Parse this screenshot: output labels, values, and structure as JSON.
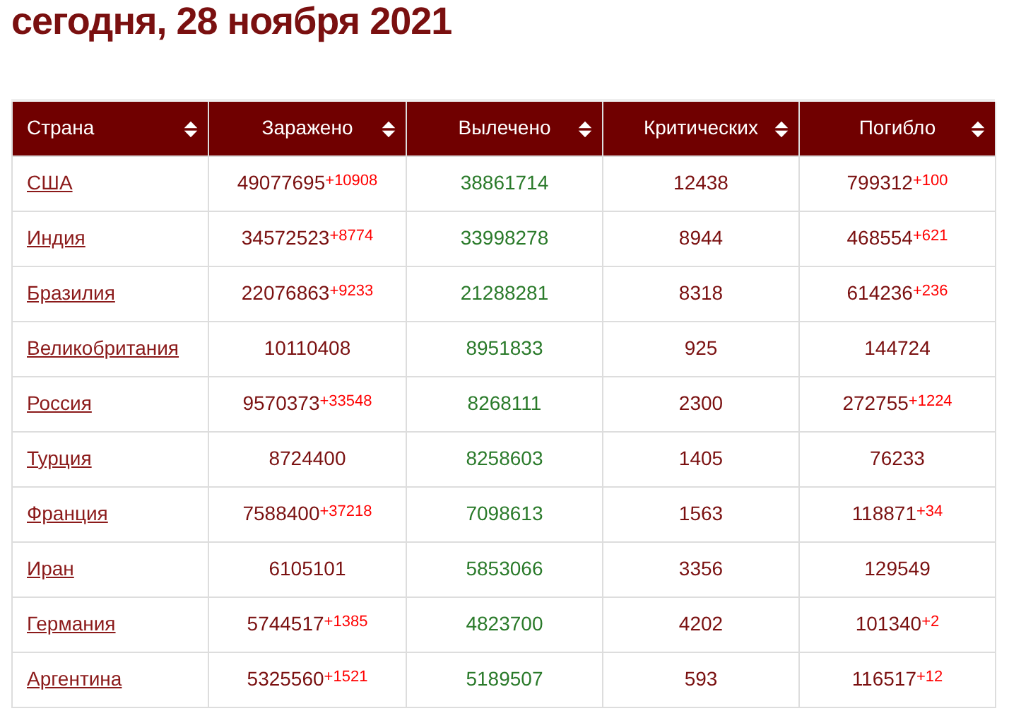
{
  "heading": "сегодня, 28 ноября 2021",
  "table": {
    "columns": [
      "Страна",
      "Заражено",
      "Вылечено",
      "Критических",
      "Погибло"
    ],
    "rows": [
      {
        "country": "США",
        "infected": "49077695",
        "infected_new": "+10908",
        "recovered": "38861714",
        "critical": "12438",
        "deaths": "799312",
        "deaths_new": "+100"
      },
      {
        "country": "Индия",
        "infected": "34572523",
        "infected_new": "+8774",
        "recovered": "33998278",
        "critical": "8944",
        "deaths": "468554",
        "deaths_new": "+621"
      },
      {
        "country": "Бразилия",
        "infected": "22076863",
        "infected_new": "+9233",
        "recovered": "21288281",
        "critical": "8318",
        "deaths": "614236",
        "deaths_new": "+236"
      },
      {
        "country": "Великобритания",
        "infected": "10110408",
        "recovered": "8951833",
        "critical": "925",
        "deaths": "144724"
      },
      {
        "country": "Россия",
        "infected": "9570373",
        "infected_new": "+33548",
        "recovered": "8268111",
        "critical": "2300",
        "deaths": "272755",
        "deaths_new": "+1224"
      },
      {
        "country": "Турция",
        "infected": "8724400",
        "recovered": "8258603",
        "critical": "1405",
        "deaths": "76233"
      },
      {
        "country": "Франция",
        "infected": "7588400",
        "infected_new": "+37218",
        "recovered": "7098613",
        "critical": "1563",
        "deaths": "118871",
        "deaths_new": "+34"
      },
      {
        "country": "Иран",
        "infected": "6105101",
        "recovered": "5853066",
        "critical": "3356",
        "deaths": "129549"
      },
      {
        "country": "Германия",
        "infected": "5744517",
        "infected_new": "+1385",
        "recovered": "4823700",
        "critical": "4202",
        "deaths": "101340",
        "deaths_new": "+2"
      },
      {
        "country": "Аргентина",
        "infected": "5325560",
        "infected_new": "+1521",
        "recovered": "5189507",
        "critical": "593",
        "deaths": "116517",
        "deaths_new": "+12"
      }
    ]
  }
}
